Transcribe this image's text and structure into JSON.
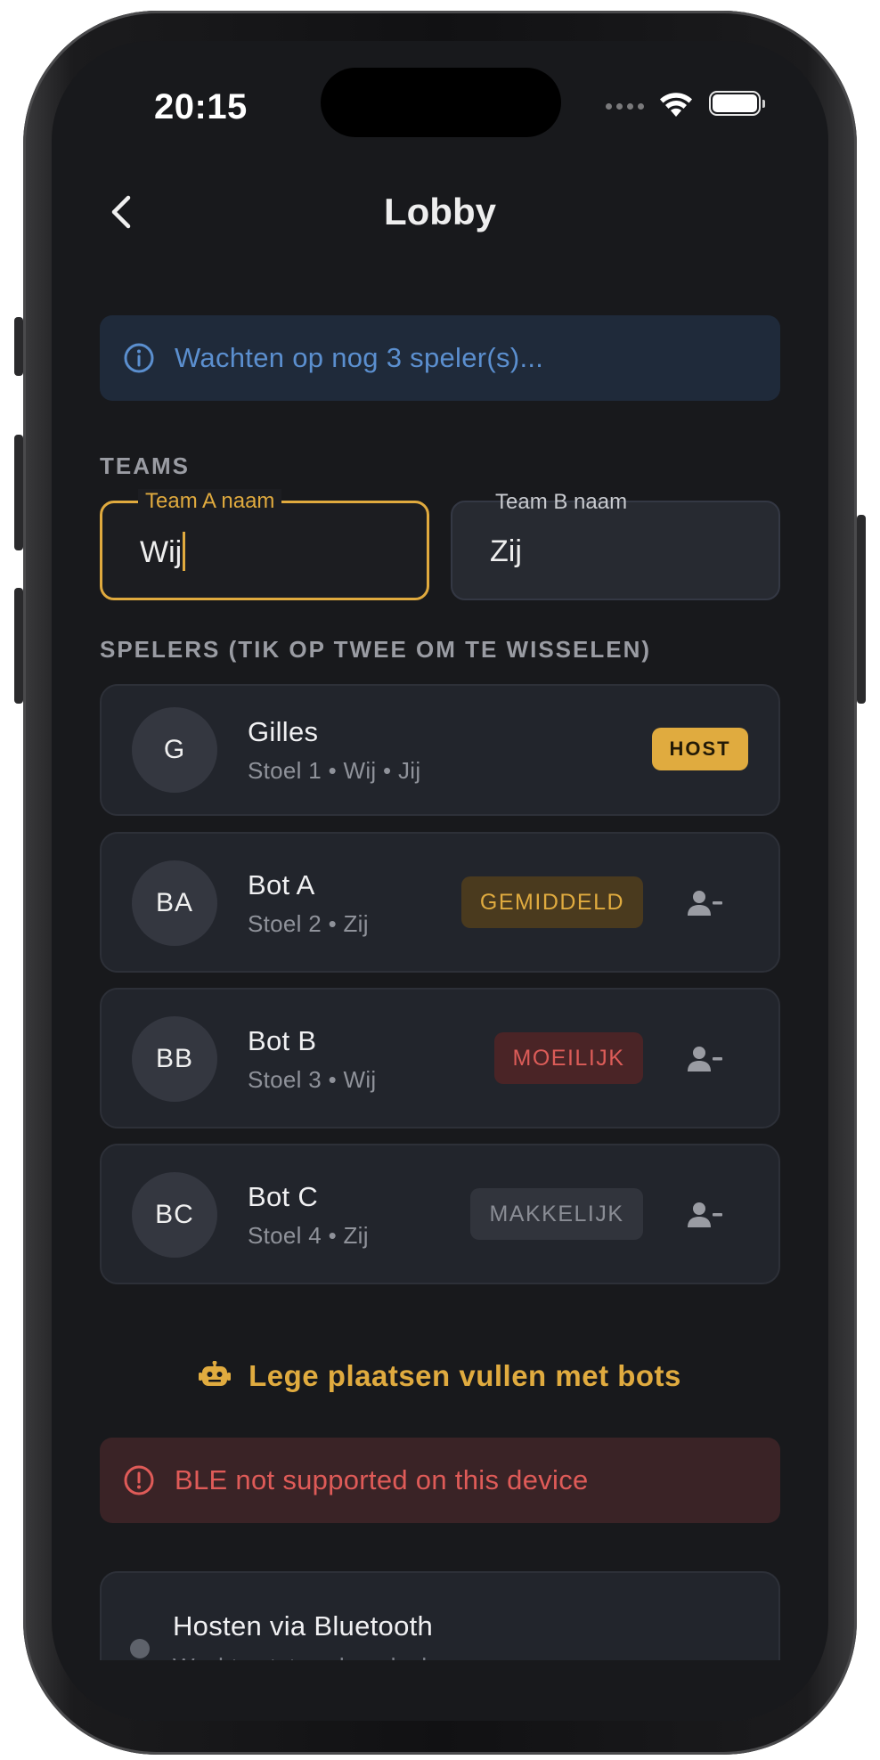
{
  "status_bar": {
    "time": "20:15"
  },
  "header": {
    "title": "Lobby"
  },
  "info_banner": {
    "text": "Wachten op nog 3 speler(s)..."
  },
  "teams": {
    "section_label": "TEAMS",
    "team_a": {
      "label": "Team A naam",
      "value": "Wij"
    },
    "team_b": {
      "label": "Team B naam",
      "value": "Zij"
    }
  },
  "players": {
    "section_label": "SPELERS (TIK OP TWEE OM TE WISSELEN)",
    "items": [
      {
        "initials": "G",
        "name": "Gilles",
        "subtitle": "Stoel 1 • Wij • Jij",
        "badge": "HOST"
      },
      {
        "initials": "BA",
        "name": "Bot A",
        "subtitle": "Stoel 2 • Zij",
        "badge": "GEMIDDELD"
      },
      {
        "initials": "BB",
        "name": "Bot B",
        "subtitle": "Stoel 3 • Wij",
        "badge": "MOEILIJK"
      },
      {
        "initials": "BC",
        "name": "Bot C",
        "subtitle": "Stoel 4 • Zij",
        "badge": "MAKKELIJK"
      }
    ]
  },
  "fill_bots": {
    "label": "Lege plaatsen vullen met bots"
  },
  "error_banner": {
    "text": "BLE not supported on this device"
  },
  "bluetooth": {
    "title": "Hosten via Bluetooth",
    "subtitle": "Wachten tot spelers deelnemen"
  },
  "colors": {
    "accent": "#e0ab3f",
    "info": "#5b8fcf",
    "error": "#df5b58",
    "background": "#18191c",
    "card": "#22252c"
  },
  "icons": {
    "back": "chevron-left-icon",
    "info": "info-circle-icon",
    "remove_player": "person-remove-icon",
    "robot": "robot-icon",
    "error": "alert-circle-icon"
  }
}
